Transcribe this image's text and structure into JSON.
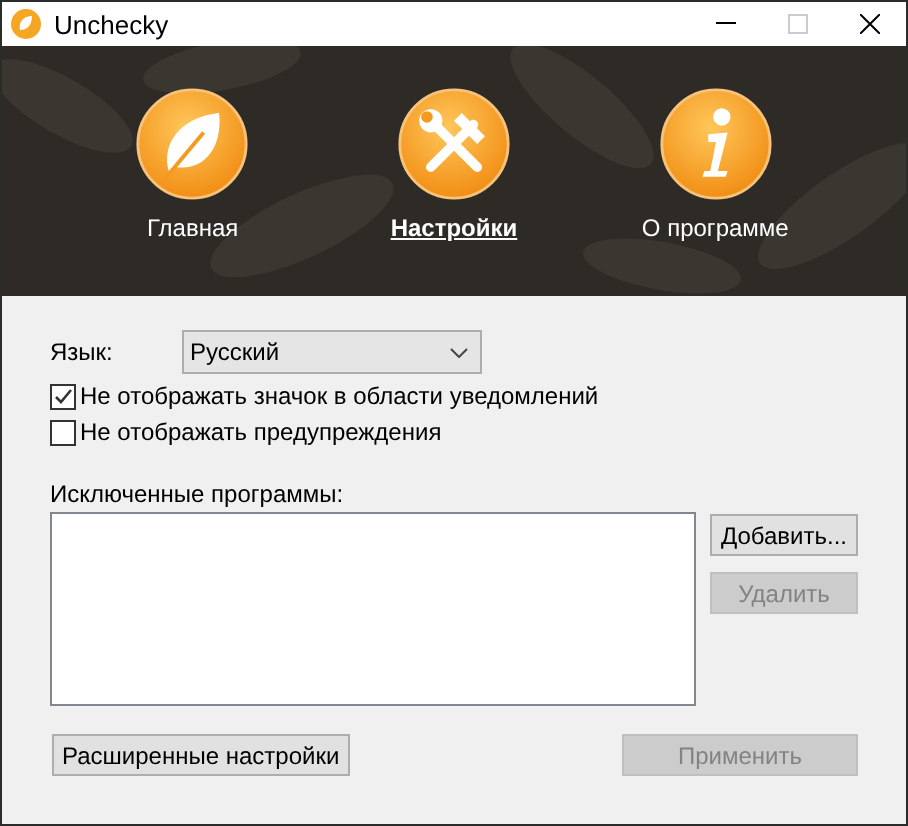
{
  "window": {
    "title": "Unchecky"
  },
  "tabs": [
    {
      "label": "Главная",
      "kind": "leaf",
      "selected": false
    },
    {
      "label": "Настройки",
      "kind": "tools",
      "selected": true
    },
    {
      "label": "О программе",
      "kind": "info",
      "selected": false
    }
  ],
  "language": {
    "label": "Язык:",
    "value": "Русский"
  },
  "options": [
    {
      "label": "Не отображать значок в области уведомлений",
      "checked": true
    },
    {
      "label": "Не отображать предупреждения",
      "checked": false
    }
  ],
  "excluded": {
    "label": "Исключенные программы:"
  },
  "side_buttons": [
    {
      "label": "Добавить...",
      "disabled": false
    },
    {
      "label": "Удалить",
      "disabled": true
    }
  ],
  "bottom_buttons": [
    {
      "label": "Расширенные настройки",
      "disabled": false
    },
    {
      "label": "Применить",
      "disabled": true
    }
  ]
}
